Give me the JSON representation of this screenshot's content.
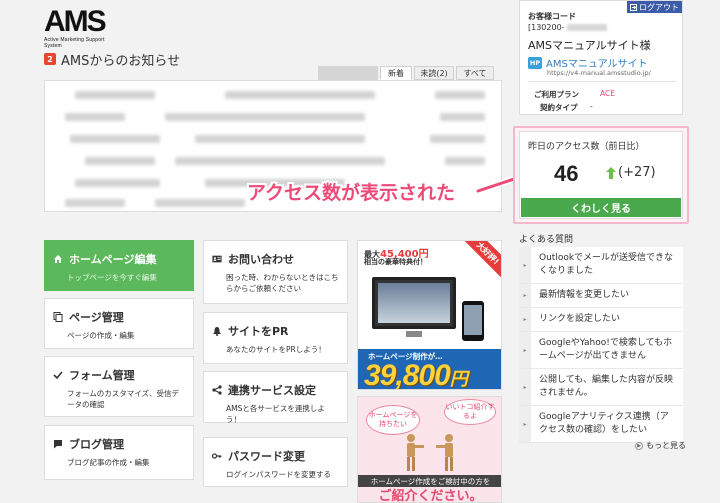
{
  "logo": {
    "main": "AMS",
    "sub": "Active Marketing Support System"
  },
  "news": {
    "badge": "2",
    "title": "AMSからのお知らせ",
    "tabs": [
      {
        "label": "新着",
        "active": true
      },
      {
        "label": "未読(2)",
        "active": false
      },
      {
        "label": "すべて",
        "active": false
      }
    ]
  },
  "annotation": {
    "text": "アクセス数が表示された",
    "color": "#ed4a77"
  },
  "menu": {
    "left": [
      {
        "title": "ホームページ編集",
        "desc": "トップページを今すぐ編集",
        "icon": "home-icon",
        "active": true
      },
      {
        "title": "ページ管理",
        "desc": "ページの作成・編集",
        "icon": "pages-icon",
        "active": false
      },
      {
        "title": "フォーム管理",
        "desc": "フォームのカスタマイズ、受信データの確認",
        "icon": "check-icon",
        "active": false
      },
      {
        "title": "ブログ管理",
        "desc": "ブログ記事の作成・編集",
        "icon": "blog-icon",
        "active": false
      }
    ],
    "right": [
      {
        "title": "お問い合わせ",
        "desc": "困った時、わからないときはこちらからご依頼ください",
        "icon": "contact-card-icon"
      },
      {
        "title": "サイトをPR",
        "desc": "あなたのサイトをPRしよう！",
        "icon": "bell-icon"
      },
      {
        "title": "連携サービス設定",
        "desc": "AMSと各サービスを連携しよう！",
        "icon": "share-icon"
      },
      {
        "title": "パスワード変更",
        "desc": "ログインパスワードを変更する",
        "icon": "key-icon"
      }
    ]
  },
  "banner1": {
    "line1_prefix": "最大",
    "line1_amount": "45,400円",
    "line2": "相当の豪華特典付！",
    "corner": "大好評!",
    "band": "ホームページ制作が…",
    "price": "39,800",
    "yen": "円"
  },
  "banner2": {
    "bubble1": "ホームページを持ちたい",
    "bubble2": "いいトコ紹介するよ",
    "band": "ホームページ作成をご検討中の方を",
    "big": "ご紹介ください。"
  },
  "customer": {
    "logout": "ログアウト",
    "code_label": "お客様コード",
    "code_value": "[130200-",
    "name": "AMSマニュアルサイト様",
    "hp_badge": "HP",
    "site_name": "AMSマニュアルサイト",
    "site_url": "https://v4-manual.amsstudio.jp/",
    "plan_label": "ご利用プラン",
    "plan_value": "ACE",
    "type_label": "契約タイプ",
    "type_value": "-"
  },
  "access": {
    "title": "昨日のアクセス数（前日比）",
    "count": "46",
    "diff": "(+27)",
    "button": "くわしく見る"
  },
  "faq": {
    "title": "よくある質問",
    "items": [
      "Outlookでメールが送受信できなくなりました",
      "最新情報を変更したい",
      "リンクを設定したい",
      "GoogleやYahoo!で検索してもホームページが出てきません",
      "公開しても、編集した内容が反映されません。",
      "Googleアナリティクス連携（アクセス数の確認）をしたい"
    ],
    "more": "もっと見る"
  },
  "colors": {
    "green": "#5cb85c",
    "accent_pink": "#ed4a77",
    "link_blue": "#2f7ec1",
    "logout_blue": "#3b5bab"
  }
}
